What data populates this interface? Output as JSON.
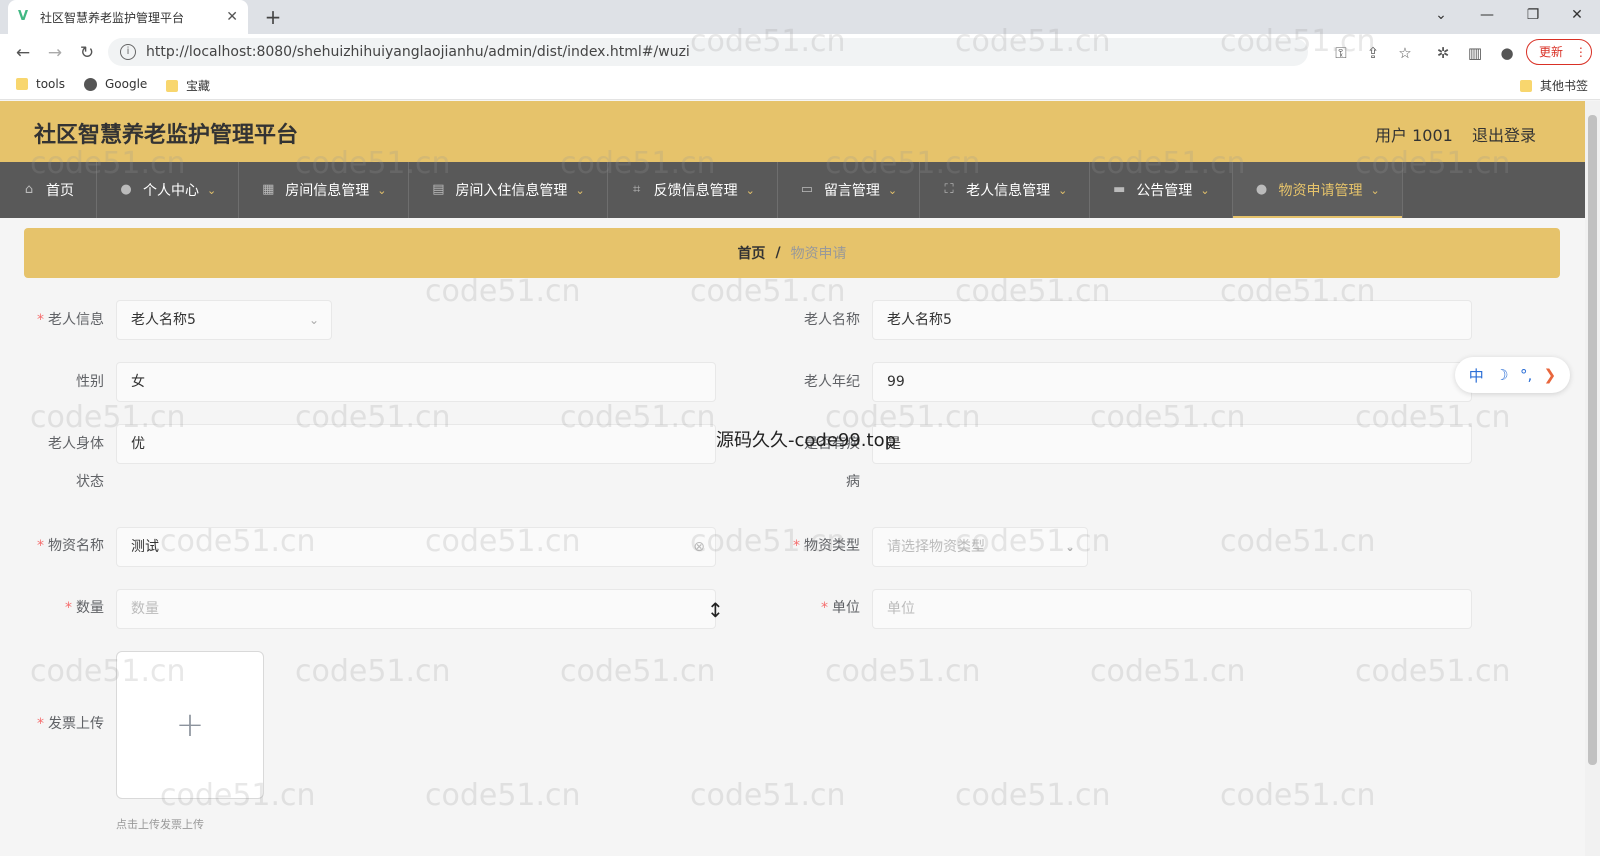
{
  "browser": {
    "tab_title": "社区智慧养老监护管理平台",
    "tab_close": "✕",
    "new_tab": "+",
    "url": "http://localhost:8080/shehuizhihuiyanglaojianhu/admin/dist/index.html#/wuzi",
    "update_label": "更新",
    "bookmarks": [
      "tools",
      "Google",
      "宝藏"
    ],
    "other_bookmarks": "其他书签"
  },
  "header": {
    "title": "社区智慧养老监护管理平台",
    "user": "用户 1001",
    "logout": "退出登录"
  },
  "nav": {
    "items": [
      {
        "label": "首页",
        "icon": "home-icon"
      },
      {
        "label": "个人中心",
        "icon": "user-icon"
      },
      {
        "label": "房间信息管理",
        "icon": "grid-icon"
      },
      {
        "label": "房间入住信息管理",
        "icon": "doc-icon"
      },
      {
        "label": "反馈信息管理",
        "icon": "crop-icon"
      },
      {
        "label": "留言管理",
        "icon": "chat-icon"
      },
      {
        "label": "老人信息管理",
        "icon": "fullscreen-icon"
      },
      {
        "label": "公告管理",
        "icon": "monitor-icon"
      },
      {
        "label": "物资申请管理",
        "icon": "user-icon"
      }
    ],
    "accent": "#e6c36b"
  },
  "breadcrumb": {
    "home": "首页",
    "separator": "/",
    "current": "物资申请"
  },
  "form": {
    "elder_info": {
      "label": "老人信息",
      "value": "老人名称5"
    },
    "elder_name": {
      "label": "老人名称",
      "value": "老人名称5"
    },
    "gender": {
      "label": "性别",
      "value": "女"
    },
    "elder_age": {
      "label": "老人年纪",
      "value": "99"
    },
    "body_status": {
      "label_line1": "老人身体",
      "label_line2": "状态",
      "value": "优"
    },
    "has_disease": {
      "label_line1": "是否有疾",
      "label_line2": "病",
      "value": "是"
    },
    "material_name": {
      "label": "物资名称",
      "value": "测试"
    },
    "material_type": {
      "label": "物资类型",
      "placeholder": "请选择物资类型"
    },
    "quantity": {
      "label": "数量",
      "placeholder": "数量"
    },
    "unit": {
      "label": "单位",
      "placeholder": "单位"
    },
    "invoice": {
      "label": "发票上传",
      "tip": "点击上传发票上传"
    }
  },
  "side_widget": {
    "lang": "中",
    "moon": "☽",
    "punct": "°,",
    "arrow": "❯"
  },
  "center_text": "源码久久-code99.top",
  "watermark": "code51.cn"
}
